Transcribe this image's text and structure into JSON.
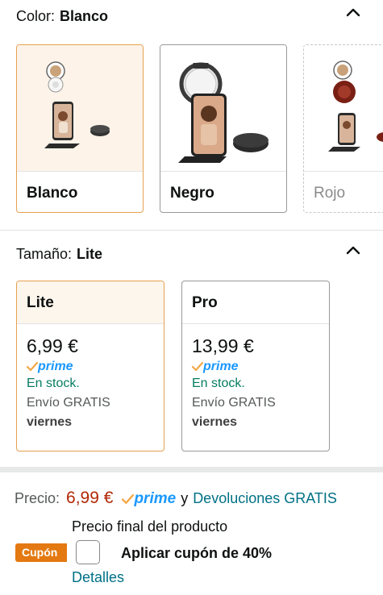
{
  "color_section": {
    "label": "Color:",
    "selected_value": "Blanco",
    "options": [
      {
        "name": "Blanco",
        "selected": true
      },
      {
        "name": "Negro",
        "selected": false
      },
      {
        "name": "Rojo",
        "selected": false
      }
    ]
  },
  "size_section": {
    "label": "Tamaño:",
    "selected_value": "Lite",
    "options": [
      {
        "name": "Lite",
        "price": "6,99 €",
        "prime": "prime",
        "stock": "En stock.",
        "shipping": "Envío GRATIS",
        "delivery_day": "viernes",
        "selected": true
      },
      {
        "name": "Pro",
        "price": "13,99 €",
        "prime": "prime",
        "stock": "En stock.",
        "shipping": "Envío GRATIS",
        "delivery_day": "viernes",
        "selected": false
      }
    ]
  },
  "summary": {
    "price_label": "Precio:",
    "price": "6,99 €",
    "prime": "prime",
    "connector": "y",
    "returns_link": "Devoluciones GRATIS",
    "final_note": "Precio final del producto"
  },
  "coupon": {
    "badge": "Cupón",
    "text": "Aplicar cupón de 40%",
    "checked": false,
    "details_link": "Detalles"
  },
  "colors": {
    "selected_border": "#e6a150",
    "price_red": "#b12704",
    "link_teal": "#007185",
    "stock_green": "#067d62",
    "prime_blue": "#1a98ff",
    "prime_check": "#f3a847",
    "coupon_orange": "#e47911"
  }
}
